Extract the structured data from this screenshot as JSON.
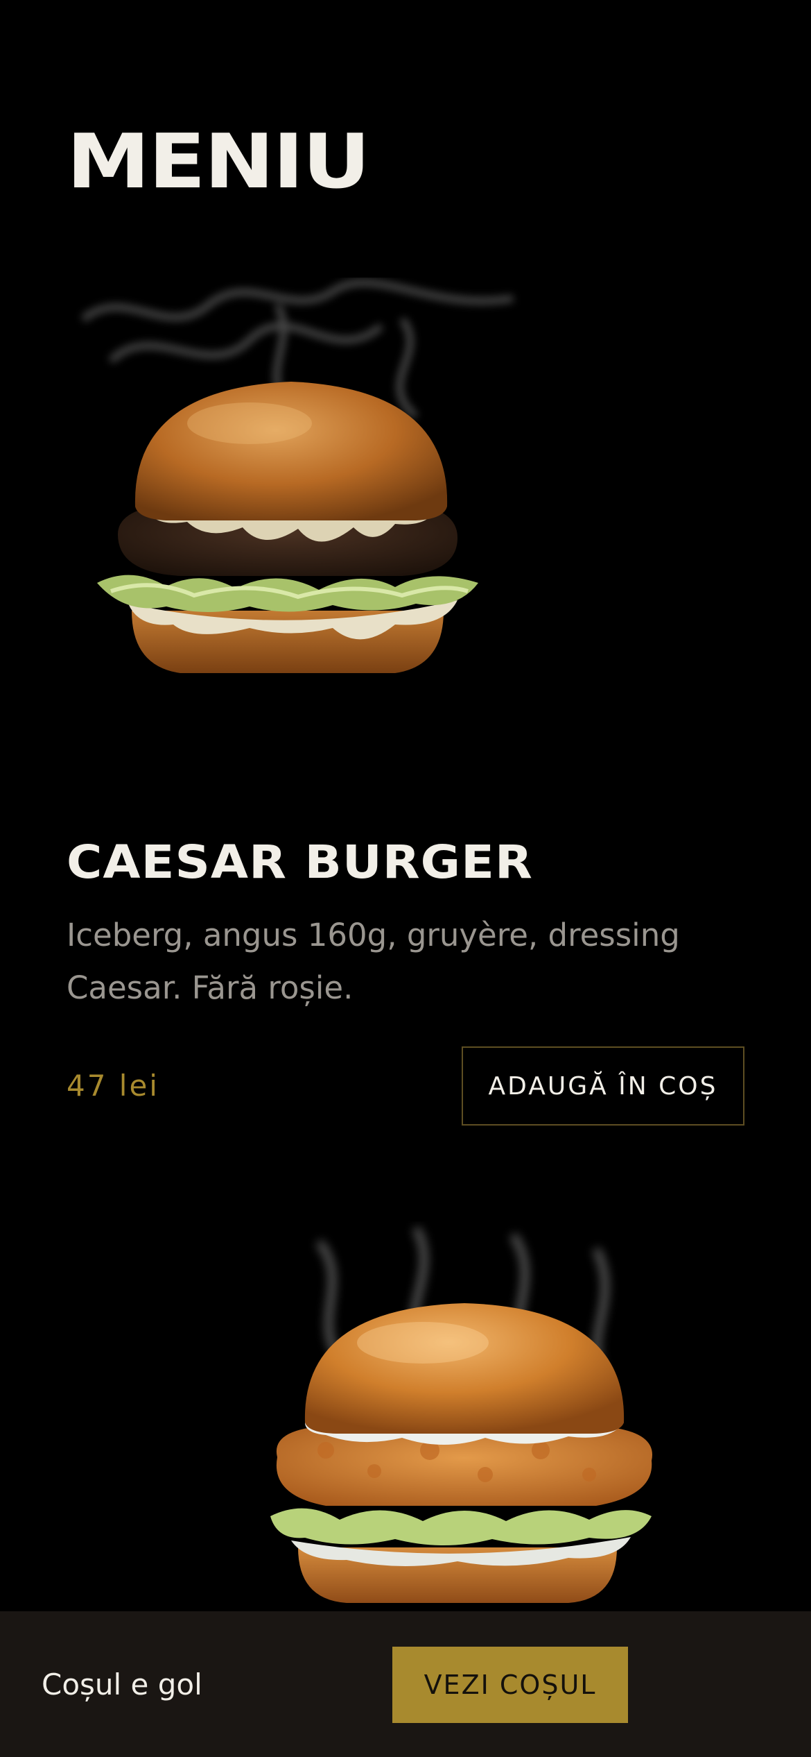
{
  "page": {
    "title": "MENIU"
  },
  "products": [
    {
      "name": "CAESAR BURGER",
      "description": "Iceberg, angus 160g, gruyère, dressing Caesar. Fără roșie.",
      "price": "47 lei",
      "add_label": "ADAUGĂ ÎN COȘ",
      "image": "caesar-burger-photo"
    },
    {
      "image": "crispy-chicken-burger-photo"
    }
  ],
  "cart": {
    "status": "Coșul e gol",
    "view_label": "VEZI COȘUL"
  },
  "colors": {
    "background": "#000000",
    "text": "#f2efe8",
    "muted": "#9a9690",
    "accent": "#a88a2e",
    "bar": "#1a1613"
  }
}
